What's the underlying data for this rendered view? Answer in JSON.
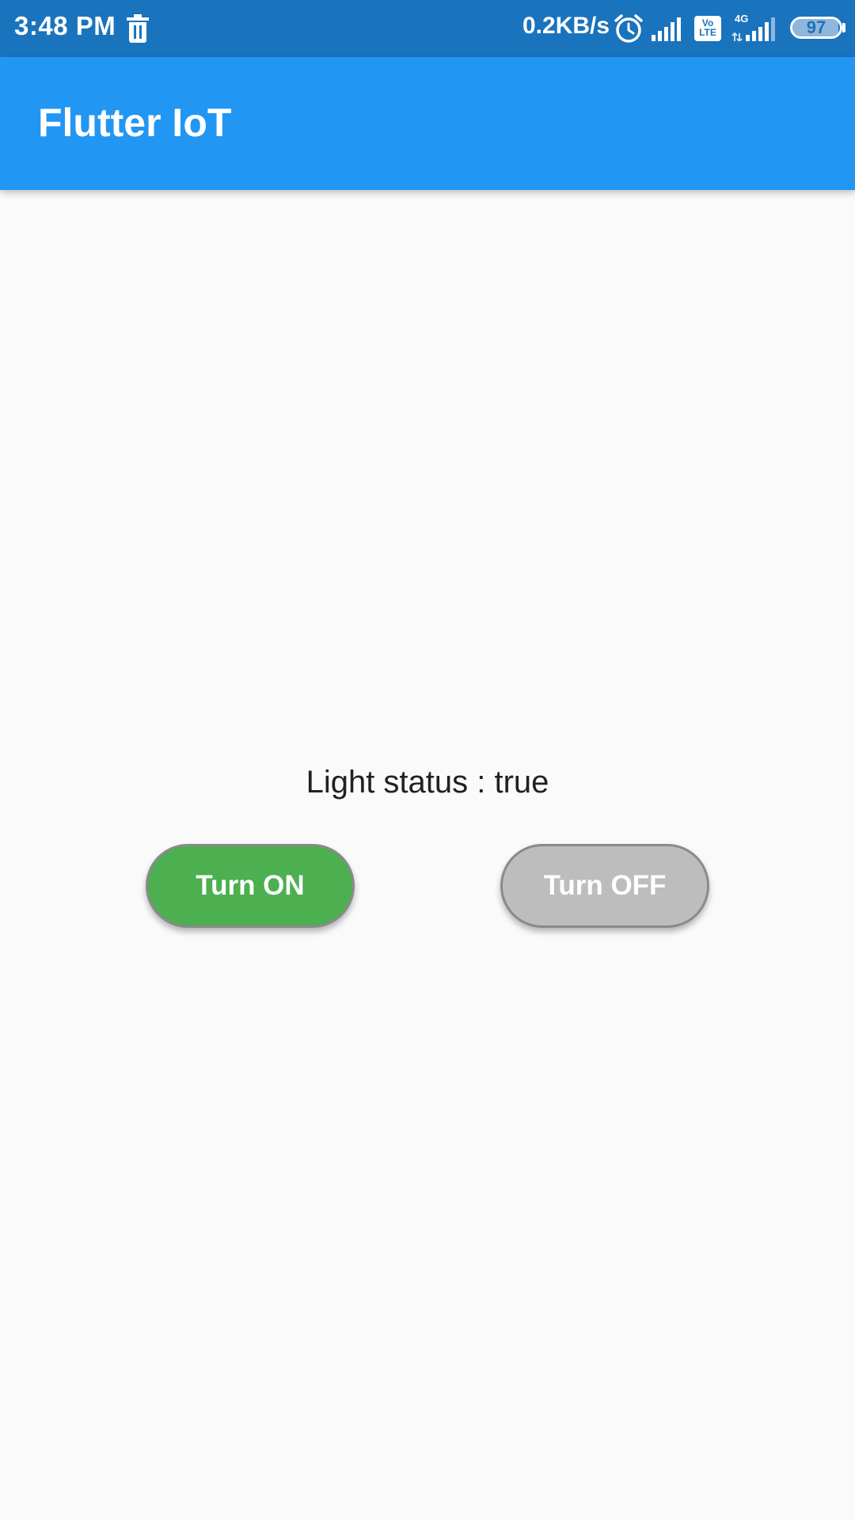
{
  "status_bar": {
    "time": "3:48 PM",
    "network_speed": "0.2KB/s",
    "volte_top": "Vo",
    "volte_bottom": "LTE",
    "network_type": "4G",
    "battery_level": "97",
    "battery_fraction": 0.97,
    "icons": [
      "trash-icon",
      "alarm-icon",
      "signal-icon",
      "volte-icon",
      "signal-4g-icon",
      "battery-icon"
    ]
  },
  "app_bar": {
    "title": "Flutter IoT"
  },
  "main": {
    "status_text": "Light status : true",
    "on_button_label": "Turn ON",
    "off_button_label": "Turn OFF"
  },
  "colors": {
    "status_bar": "#1a73bd",
    "app_bar": "#2196f3",
    "background": "#fafafa",
    "on_button": "#4caf50",
    "off_button": "#bdbdbd",
    "text": "#212121"
  }
}
